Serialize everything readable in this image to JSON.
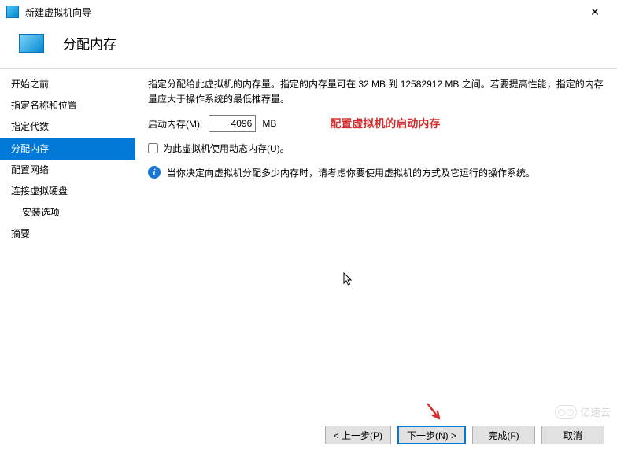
{
  "titlebar": {
    "title": "新建虚拟机向导"
  },
  "header": {
    "title": "分配内存"
  },
  "sidebar": {
    "items": [
      {
        "label": "开始之前"
      },
      {
        "label": "指定名称和位置"
      },
      {
        "label": "指定代数"
      },
      {
        "label": "分配内存"
      },
      {
        "label": "配置网络"
      },
      {
        "label": "连接虚拟硬盘"
      },
      {
        "label": "安装选项"
      },
      {
        "label": "摘要"
      }
    ]
  },
  "main": {
    "desc_prefix": "指定分配给此虚拟机的内存量。指定的内存量可在 ",
    "min_mb": "32 MB",
    "to": " 到 ",
    "max_mb": "12582912 MB",
    "desc_suffix": " 之间。若要提高性能，指定的内存量应大于操作系统的最低推荐量。",
    "mem_label": "启动内存(M):",
    "mem_value": "4096",
    "mem_unit": "MB",
    "annotation": "配置虚拟机的启动内存",
    "dynmem_label": "为此虚拟机使用动态内存(U)。",
    "info_text": "当你决定向虚拟机分配多少内存时，请考虑你要使用虚拟机的方式及它运行的操作系统。"
  },
  "footer": {
    "prev": "< 上一步(P)",
    "next": "下一步(N) >",
    "finish": "完成(F)",
    "cancel": "取消"
  },
  "watermark": "亿速云"
}
